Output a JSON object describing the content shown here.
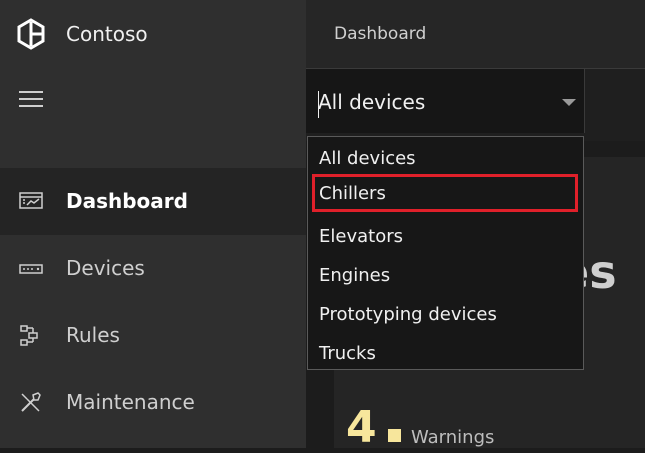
{
  "brand": {
    "name": "Contoso",
    "logo_icon": "contoso-logo-icon"
  },
  "sidebar": {
    "menu_icon": "hamburger-icon",
    "items": [
      {
        "label": "Dashboard",
        "icon": "dashboard-icon",
        "active": true
      },
      {
        "label": "Devices",
        "icon": "devices-icon",
        "active": false
      },
      {
        "label": "Rules",
        "icon": "rules-icon",
        "active": false
      },
      {
        "label": "Maintenance",
        "icon": "maintenance-icon",
        "active": false
      }
    ]
  },
  "header": {
    "breadcrumb": "Dashboard"
  },
  "filter": {
    "selected": "All devices",
    "options": [
      "All devices",
      "Chillers",
      "Elevators",
      "Engines",
      "Prototyping devices",
      "Trucks"
    ],
    "highlighted": "Chillers"
  },
  "background_panel": {
    "partial_text": "es",
    "warnings_count": "4",
    "warnings_label": "Warnings"
  },
  "colors": {
    "sidebar": "#2f2f2f",
    "main": "#1c1c1c",
    "highlight": "#e0202a",
    "warning": "#f7e69c"
  }
}
